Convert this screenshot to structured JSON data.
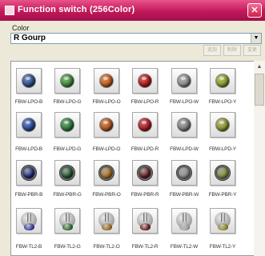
{
  "window": {
    "title": "Function switch (256Color)",
    "accent_color": "#c2185b",
    "close_icon": "close-icon"
  },
  "color_selector": {
    "label": "Color",
    "selected": "R Gourp"
  },
  "toolbar": {
    "buttons": [
      "追加",
      "削除",
      "変更"
    ],
    "state": "disabled"
  },
  "panel": {
    "rows": [
      {
        "style": "lamp",
        "items": [
          {
            "label": "FBW-LPO-B",
            "color": "#2f4f8e"
          },
          {
            "label": "FBW-LPO-G",
            "color": "#3f8a36"
          },
          {
            "label": "FBW-LPO-O",
            "color": "#c05a1a"
          },
          {
            "label": "FBW-LPO-R",
            "color": "#b01818"
          },
          {
            "label": "FBW-LPO-W",
            "color": "#8a8a8a"
          },
          {
            "label": "FBW-LPO-Y",
            "color": "#8a9a2a"
          }
        ]
      },
      {
        "style": "lamp",
        "items": [
          {
            "label": "FBW-LPD-B",
            "color": "#2a4a9a"
          },
          {
            "label": "FBW-LPD-G",
            "color": "#2e7a3a"
          },
          {
            "label": "FBW-LPD-O",
            "color": "#b0561a"
          },
          {
            "label": "FBW-LPD-R",
            "color": "#a81b22"
          },
          {
            "label": "FBW-LPD-W",
            "color": "#7f7f7f"
          },
          {
            "label": "FBW-LPD-Y",
            "color": "#8c9232"
          }
        ]
      },
      {
        "style": "ring",
        "items": [
          {
            "label": "FBW-PBR-B",
            "color": "#1c2a8a"
          },
          {
            "label": "FBW-PBR-G",
            "color": "#1e5a28"
          },
          {
            "label": "FBW-PBR-O",
            "color": "#b87a1a"
          },
          {
            "label": "FBW-PBR-R",
            "color": "#6a1a1a"
          },
          {
            "label": "FBW-PBR-W",
            "color": "#9a9a9a"
          },
          {
            "label": "FBW-PBR-Y",
            "color": "#8a9a3a"
          }
        ]
      },
      {
        "style": "switch",
        "items": [
          {
            "label": "FBW-TL2-B",
            "color": "#3a3a9a"
          },
          {
            "label": "FBW-TL2-G",
            "color": "#2a6a2a"
          },
          {
            "label": "FBW-TL2-O",
            "color": "#9a6a1a"
          },
          {
            "label": "FBW-TL2-R",
            "color": "#6a1a1a"
          },
          {
            "label": "FBW-TL2-W",
            "color": "#a0a0a0"
          },
          {
            "label": "FBW-TL2-Y",
            "color": "#8a8a2a"
          }
        ]
      }
    ]
  }
}
